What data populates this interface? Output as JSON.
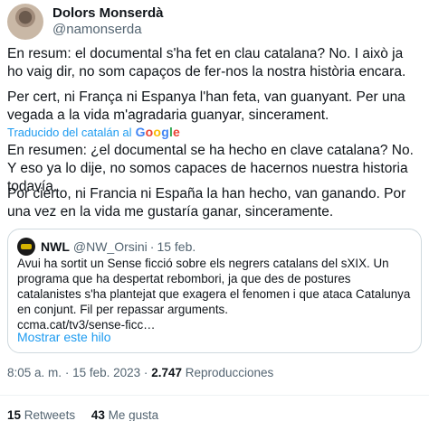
{
  "author": {
    "display_name": "Dolors Monserdà",
    "handle": "@namonserda"
  },
  "tweet": {
    "original_paragraphs": [
      "En resum: el documental s'ha fet en clau catalana? No. I això ja ho vaig dir, no som capaços de fer-nos la nostra història encara.",
      "Per cert, ni França ni Espanya l'han feta, van guanyant. Per una vegada a la vida m'agradaria guanyar, sincerament."
    ],
    "translated_from_label": "Traducido del catalán al",
    "translated_by": "Google",
    "translated_paragraphs": [
      "En resumen: ¿el documental se ha hecho en clave catalana? No. Y eso ya lo dije, no somos capaces de hacernos nuestra historia todavía.",
      "Por cierto, ni Francia ni España la han hecho, van ganando. Por una vez en la vida me gustaría ganar, sinceramente."
    ]
  },
  "quoted_tweet": {
    "name": "NWL",
    "handle": "@NW_Orsini",
    "separator": "·",
    "date": "15 feb.",
    "text": "Avui ha sortit un Sense ficció sobre els negrers catalans del sXIX. Un programa que ha despertat rebombori, ja que des de postures catalanistes s'ha plantejat que exagera el fenomen i que ataca Catalunya en conjunt. Fil per repassar arguments.",
    "link": "ccma.cat/tv3/sense-ficc…",
    "show_thread_label": "Mostrar este hilo"
  },
  "meta": {
    "time": "8:05 a. m.",
    "dot": "·",
    "date": "15 feb. 2023",
    "views_count": "2.747",
    "views_label": "Reproducciones"
  },
  "stats": {
    "retweets_count": "15",
    "retweets_label": "Retweets",
    "likes_count": "43",
    "likes_label": "Me gusta"
  },
  "colors": {
    "accent": "#1d9bf0",
    "text": "#0f1419",
    "secondary": "#536471",
    "border": "#cfd9de"
  }
}
